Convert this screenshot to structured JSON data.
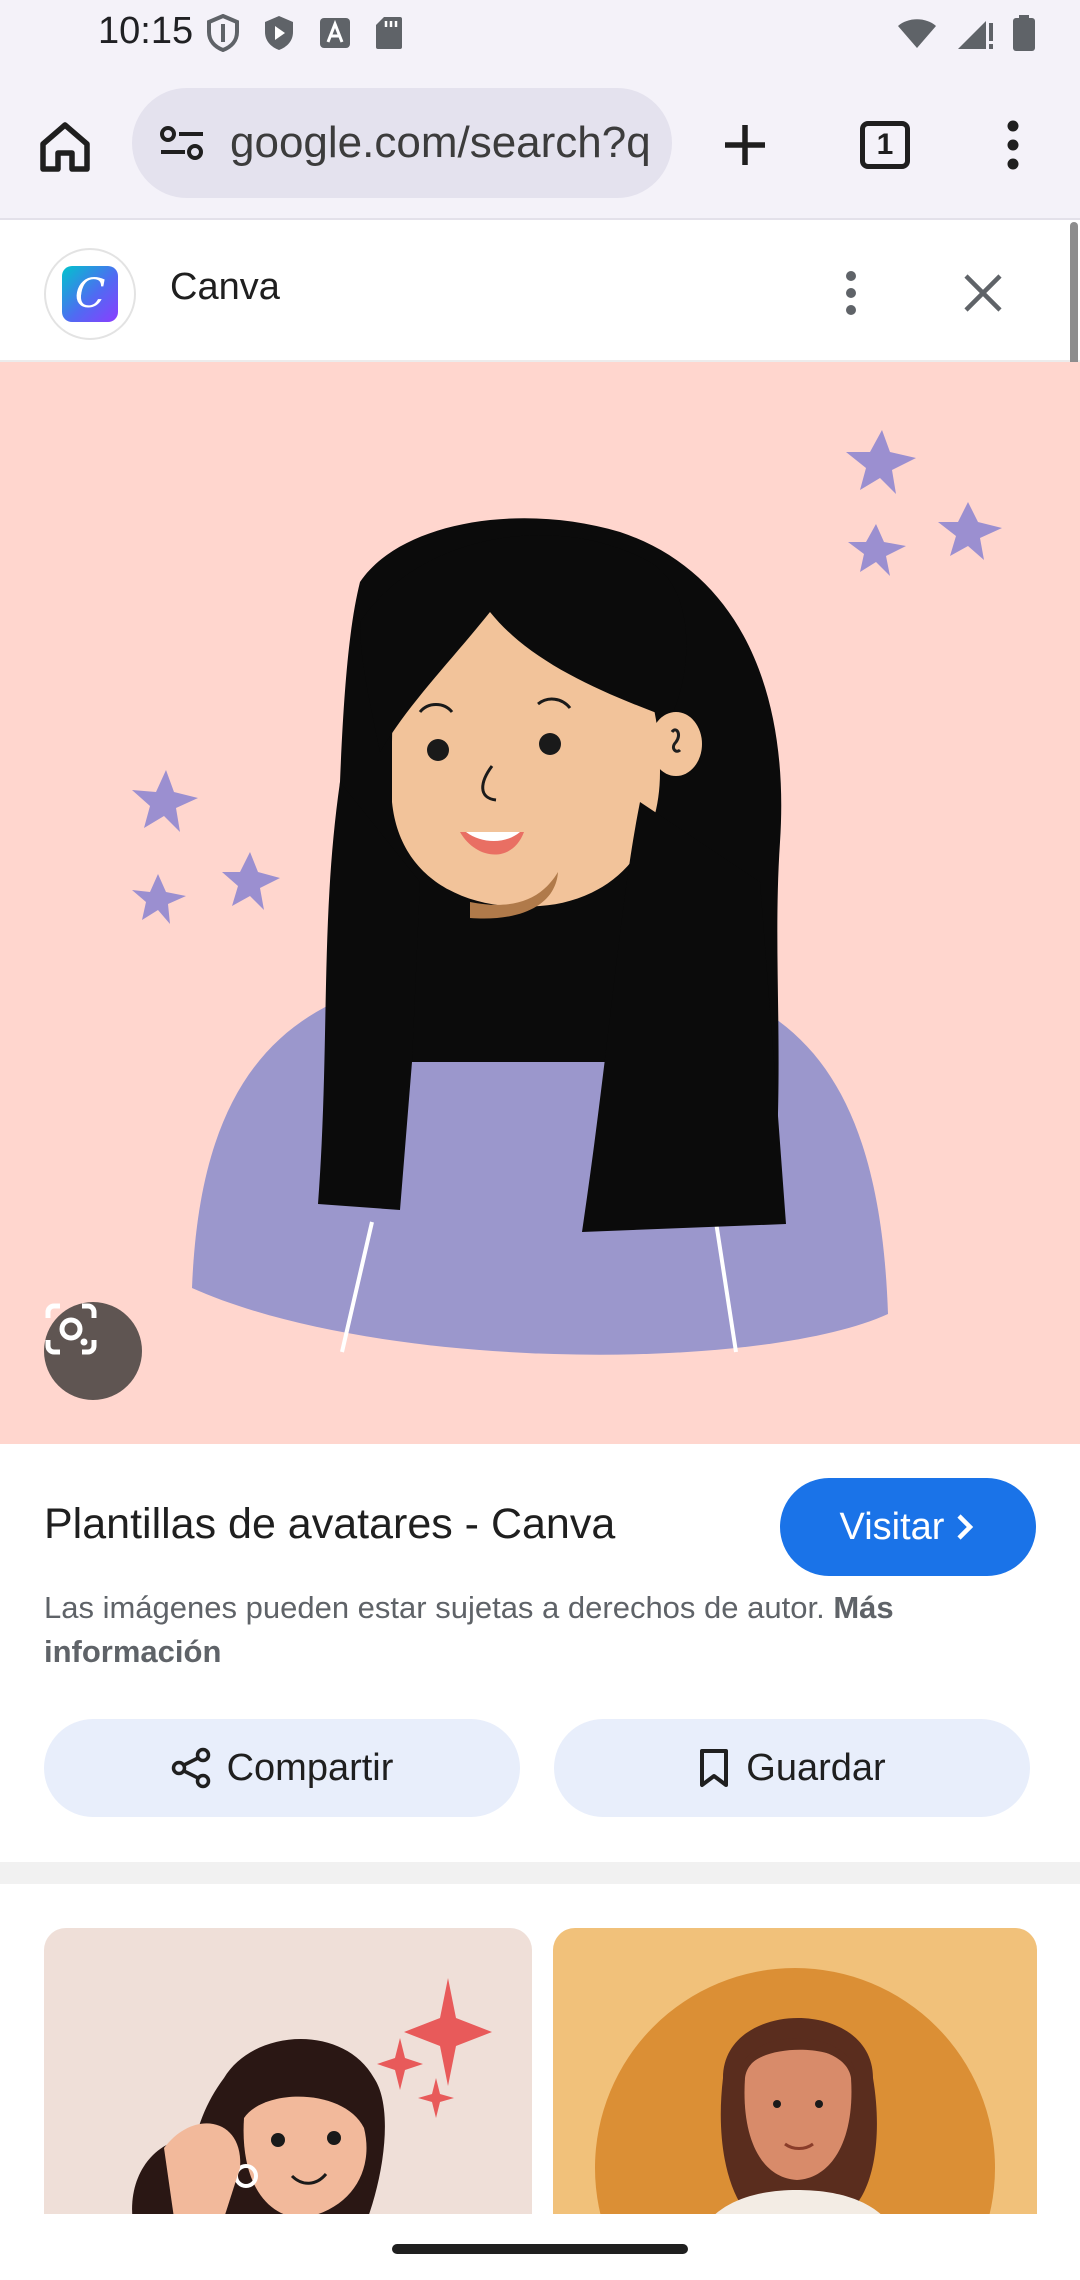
{
  "status_bar": {
    "time": "10:15"
  },
  "browser": {
    "url": "google.com/search?q",
    "tab_count": "1"
  },
  "sheet": {
    "site_name": "Canva",
    "logo_letter": "C"
  },
  "result": {
    "title": "Plantillas de avatares - Canva",
    "visit_label": "Visitar",
    "copyright_text": "Las imágenes pueden estar sujetas a derechos de autor. ",
    "more_info_link": "Más información",
    "share_label": "Compartir",
    "save_label": "Guardar"
  },
  "colors": {
    "accent": "#1a73e8",
    "image_background": "#ffd6ce",
    "chip_background": "#e8eefb"
  },
  "icons": {
    "home": "home-icon",
    "site_settings": "tune-icon",
    "new_tab": "plus-icon",
    "tabs": "tab-switcher-icon",
    "menu": "more-vert-icon",
    "close": "close-icon",
    "lens": "google-lens-icon",
    "share": "share-icon",
    "save": "bookmark-icon",
    "visit": "chevron-right-icon"
  }
}
